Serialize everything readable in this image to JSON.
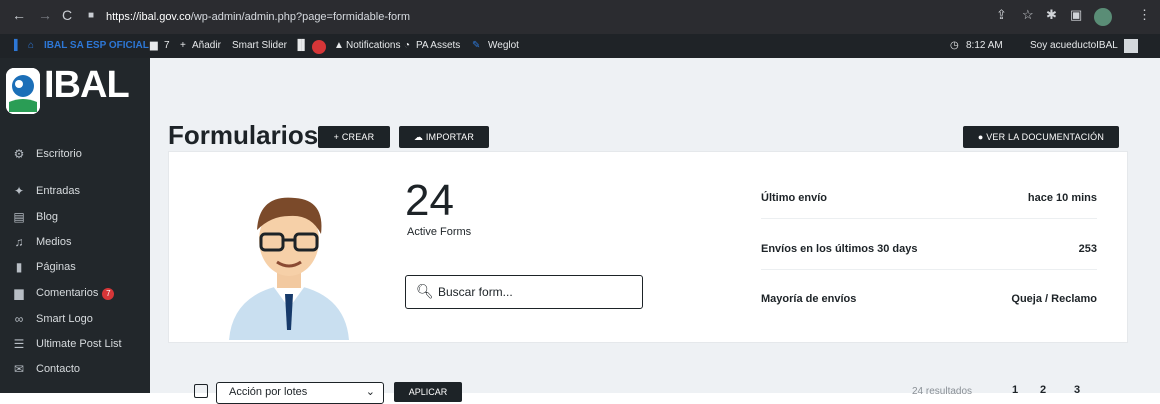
{
  "browser": {
    "url_host": "https://ibal.gov.co",
    "url_path": "/wp-admin/admin.php?page=formidable-form"
  },
  "adminbar": {
    "site_name": "IBAL SA ESP OFICIAL",
    "comments_count": "7",
    "add_new": "Añadir",
    "smart_slider": "Smart Slider",
    "notifications_badge": "",
    "notifications": "Notifications",
    "pa_assets": "PA Assets",
    "weglot": "Weglot",
    "time": "8:12 AM",
    "user": "Soy acueductoIBAL"
  },
  "sidebar": {
    "logo_text": "IBAL",
    "items": [
      {
        "label": "Escritorio",
        "icon": "dashboard-icon"
      },
      {
        "label": "Entradas",
        "icon": "pin-icon"
      },
      {
        "label": "Blog",
        "icon": "blog-icon"
      },
      {
        "label": "Medios",
        "icon": "media-icon"
      },
      {
        "label": "Páginas",
        "icon": "pages-icon"
      },
      {
        "label": "Comentarios",
        "icon": "comments-icon",
        "count": "7"
      },
      {
        "label": "Smart Logo",
        "icon": "smart-logo-icon"
      },
      {
        "label": "Ultimate Post List",
        "icon": "list-icon"
      },
      {
        "label": "Contacto",
        "icon": "mail-icon"
      }
    ]
  },
  "page": {
    "title": "Formularios",
    "create_label": "+ CREAR",
    "import_label": "IMPORTAR",
    "docs_label": "VER LA DOCUMENTACIÓN"
  },
  "card": {
    "active_count": "24",
    "active_label": "Active Forms",
    "search_placeholder": "Buscar form...",
    "stats": [
      {
        "label": "Último envío",
        "value": "hace 10 mins"
      },
      {
        "label": "Envíos en los últimos 30 days",
        "value": "253"
      },
      {
        "label": "Mayoría de envíos",
        "value": "Queja / Reclamo"
      }
    ]
  },
  "bulk": {
    "action_select": "Acción por lotes",
    "apply_label": "APLICAR",
    "results_text": "24 resultados",
    "pages": [
      "1",
      "2",
      "3"
    ]
  },
  "colors": {
    "admin_dark": "#1d2327",
    "sidebar": "#22272b",
    "notification_red": "#d63638",
    "wp_blue": "#2d77d6"
  }
}
